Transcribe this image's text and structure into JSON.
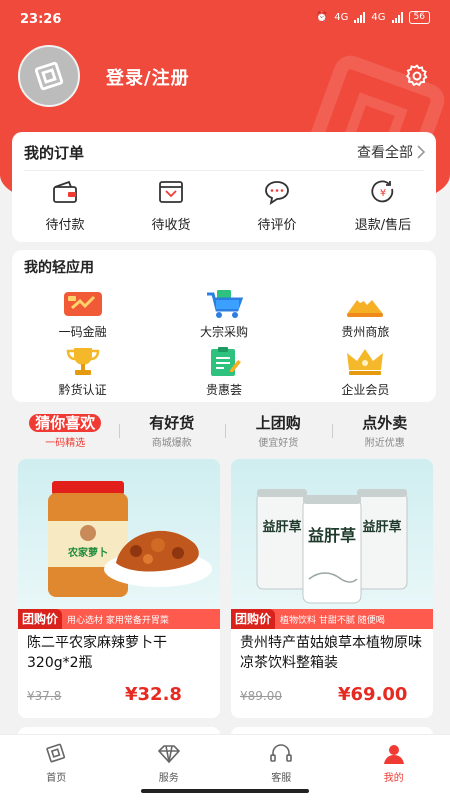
{
  "status": {
    "time": "23:26",
    "net1": "4G",
    "net2": "4G",
    "battery": "56"
  },
  "header": {
    "login_label": "登录/注册"
  },
  "orders": {
    "title": "我的订单",
    "view_all": "查看全部",
    "items": [
      {
        "label": "待付款",
        "icon": "wallet-icon"
      },
      {
        "label": "待收货",
        "icon": "inbox-icon"
      },
      {
        "label": "待评价",
        "icon": "chat-icon"
      },
      {
        "label": "退款/售后",
        "icon": "refund-icon"
      }
    ]
  },
  "apps": {
    "title": "我的轻应用",
    "items": [
      {
        "label": "一码金融",
        "icon": "finance-icon"
      },
      {
        "label": "大宗采购",
        "icon": "cart-icon"
      },
      {
        "label": "贵州商旅",
        "icon": "mountain-icon"
      },
      {
        "label": "黔货认证",
        "icon": "trophy-icon"
      },
      {
        "label": "贵惠荟",
        "icon": "clipboard-icon"
      },
      {
        "label": "企业会员",
        "icon": "crown-icon"
      }
    ]
  },
  "tabs": [
    {
      "title": "猜你喜欢",
      "sub": "一码精选"
    },
    {
      "title": "有好货",
      "sub": "商城爆款"
    },
    {
      "title": "上团购",
      "sub": "便宜好货"
    },
    {
      "title": "点外卖",
      "sub": "附近优惠"
    }
  ],
  "products": [
    {
      "tag": "团购价",
      "slogan": "用心选材 家用常备开胃菜",
      "name": "陈二平农家麻辣萝卜干320g*2瓶",
      "old_price": "¥37.8",
      "price": "¥32.8",
      "jar_label": "农家萝卜"
    },
    {
      "tag": "团购价",
      "slogan": "植物饮料 甘甜不腻 随便喝",
      "name": "贵州特产苗姑娘草本植物原味凉茶饮料整箱装",
      "old_price": "¥89.00",
      "price": "¥69.00",
      "can_text": "益肝草"
    }
  ],
  "nav": [
    {
      "label": "首页",
      "icon": "home-icon"
    },
    {
      "label": "服务",
      "icon": "diamond-icon"
    },
    {
      "label": "客服",
      "icon": "headset-icon"
    },
    {
      "label": "我的",
      "icon": "user-icon"
    }
  ],
  "colors": {
    "brand": "#ef4a3b",
    "price": "#e62a22",
    "promo": "#ff5a4e"
  }
}
